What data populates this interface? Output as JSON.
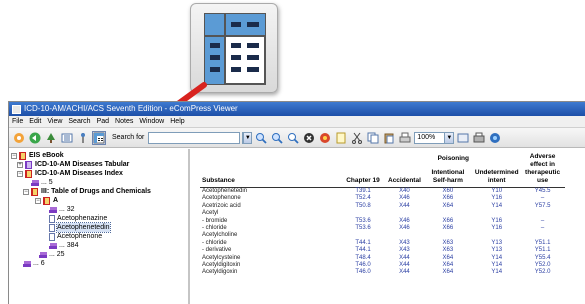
{
  "window": {
    "title": "ICD-10-AM/ACHI/ACS Seventh Edition - eComPress Viewer"
  },
  "menu": [
    "File",
    "Edit",
    "View",
    "Search",
    "Pad",
    "Notes",
    "Window",
    "Help"
  ],
  "toolbar": {
    "search_label": "Search for",
    "search_value": "",
    "zoom_value": "100%",
    "icons": [
      "home-icon",
      "back-icon",
      "tree-icon",
      "list-icon",
      "pin-icon",
      "table-view-icon",
      "search-go-icon",
      "find-icon",
      "find-next-icon",
      "find-prev-icon",
      "stop-icon",
      "bookmark-icon",
      "note-icon",
      "cut-icon",
      "copy-icon",
      "paste-icon",
      "print-icon",
      "zoom-icon",
      "help-icon"
    ]
  },
  "tree": [
    {
      "label": "EIS eBook",
      "bold": true
    },
    {
      "label": "ICD-10-AM Diseases Tabular",
      "bold": true
    },
    {
      "label": "ICD-10-AM Diseases Index",
      "bold": true
    },
    {
      "label": "... 5",
      "bold": false
    },
    {
      "label": "III: Table of Drugs and Chemicals",
      "bold": true
    },
    {
      "label": "A",
      "bold": true
    },
    {
      "label": "... 32",
      "bold": false
    },
    {
      "label": "Acetophenazine",
      "bold": false
    },
    {
      "label": "Acetophenetedin",
      "bold": false
    },
    {
      "label": "Acetophenone",
      "bold": false
    },
    {
      "label": "... 384",
      "bold": false
    },
    {
      "label": "... 25",
      "bold": false
    },
    {
      "label": "... 6",
      "bold": false
    }
  ],
  "table": {
    "headers": {
      "substance": "Substance",
      "chapter19": "Chapter 19",
      "poisoning": "Poisoning",
      "accidental": "Accidental",
      "intentional": "Intentional Self-harm",
      "undetermined": "Undetermined intent",
      "adverse": "Adverse effect in therapeutic use"
    },
    "rows": [
      {
        "substance": "Acetophenetedin",
        "chapter19": "T39.1",
        "accidental": "X40",
        "intentional": "X60",
        "undetermined": "Y10",
        "adverse": "Y45.5"
      },
      {
        "substance": "Acetophenone",
        "chapter19": "T52.4",
        "accidental": "X46",
        "intentional": "X66",
        "undetermined": "Y16",
        "adverse": "–"
      },
      {
        "substance": "Acetrizoic acid",
        "chapter19": "T50.8",
        "accidental": "X44",
        "intentional": "X64",
        "undetermined": "Y14",
        "adverse": "Y57.5"
      },
      {
        "substance": "Acetyl",
        "chapter19": "",
        "accidental": "",
        "intentional": "",
        "undetermined": "",
        "adverse": ""
      },
      {
        "substance": "- bromide",
        "chapter19": "T53.6",
        "accidental": "X46",
        "intentional": "X66",
        "undetermined": "Y16",
        "adverse": "–"
      },
      {
        "substance": "- chloride",
        "chapter19": "T53.6",
        "accidental": "X46",
        "intentional": "X66",
        "undetermined": "Y16",
        "adverse": "–"
      },
      {
        "substance": "Acetylcholine",
        "chapter19": "",
        "accidental": "",
        "intentional": "",
        "undetermined": "",
        "adverse": ""
      },
      {
        "substance": "- chloride",
        "chapter19": "T44.1",
        "accidental": "X43",
        "intentional": "X63",
        "undetermined": "Y13",
        "adverse": "Y51.1"
      },
      {
        "substance": "- derivative",
        "chapter19": "T44.1",
        "accidental": "X43",
        "intentional": "X63",
        "undetermined": "Y13",
        "adverse": "Y51.1"
      },
      {
        "substance": "Acetylcysteine",
        "chapter19": "T48.4",
        "accidental": "X44",
        "intentional": "X64",
        "undetermined": "Y14",
        "adverse": "Y55.4"
      },
      {
        "substance": "Acetyldigitoxin",
        "chapter19": "T46.0",
        "accidental": "X44",
        "intentional": "X64",
        "undetermined": "Y14",
        "adverse": "Y52.0"
      },
      {
        "substance": "Acetyldigoxin",
        "chapter19": "T46.0",
        "accidental": "X44",
        "intentional": "X64",
        "undetermined": "Y14",
        "adverse": "Y52.0"
      }
    ]
  },
  "colors": {
    "titlebar": "#2b63c0",
    "arrow": "#d8231f",
    "code_text": "#2a3ea3",
    "icon_blue": "#5b9bd5"
  }
}
